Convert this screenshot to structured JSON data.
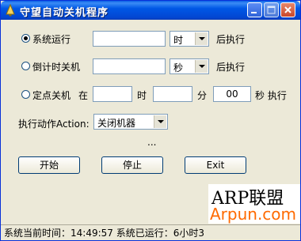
{
  "window": {
    "title": "守望自动关机程序",
    "icons": {
      "app": "bell-icon",
      "minimize": "minimize-icon",
      "maximize": "maximize-icon",
      "close": "close-icon"
    }
  },
  "rows": {
    "system_run": {
      "label": "系统运行",
      "checked": true,
      "input_value": "",
      "unit": "时",
      "suffix": "后执行"
    },
    "countdown": {
      "label": "倒计时关机",
      "checked": false,
      "input_value": "",
      "unit": "秒",
      "suffix": "后执行"
    },
    "scheduled": {
      "label": "定点关机",
      "checked": false,
      "at_label": "在",
      "hour_value": "",
      "hour_label": "时",
      "minute_value": "",
      "minute_label": "分",
      "second_value": "00",
      "second_label": "秒 执行"
    }
  },
  "action": {
    "label": "执行动作Action:",
    "selected": "关闭机器"
  },
  "ellipsis": "...",
  "buttons": {
    "start": "开始",
    "stop": "停止",
    "exit": "Exit"
  },
  "status": {
    "text": "系统当前时间：14:49:57   系统已运行：6小时3"
  },
  "watermark": {
    "line1": "ARP联盟",
    "line2": "Arpun.com"
  }
}
